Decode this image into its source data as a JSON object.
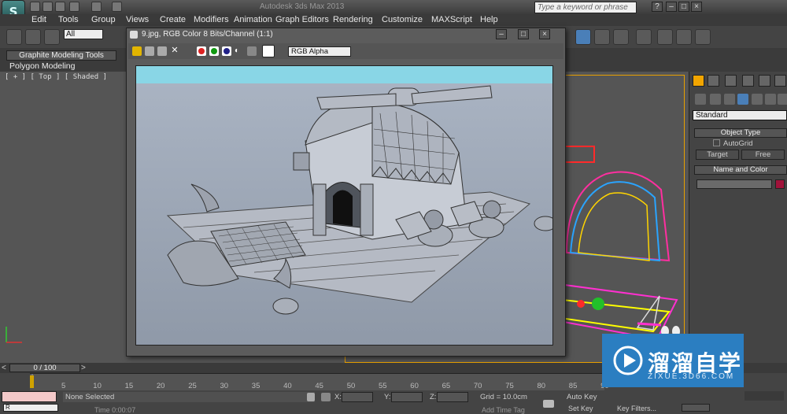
{
  "app": {
    "logo_letter": "S",
    "title_text": "Autodesk 3ds Max 2013",
    "search_placeholder": "Type a keyword or phrase",
    "window_buttons": [
      "–",
      "□",
      "×"
    ]
  },
  "menu": [
    "Edit",
    "Tools",
    "Group",
    "Views",
    "Create",
    "Modifiers",
    "Animation",
    "Graph Editors",
    "Rendering",
    "Customize",
    "MAXScript",
    "Help"
  ],
  "toolbar": {
    "selection_filter": "All"
  },
  "ribbon": {
    "tab_label": "Graphite Modeling Tools",
    "panel_label": "Polygon Modeling"
  },
  "viewport": {
    "label": "[ + ] [ Top ] [ Shaded ]"
  },
  "frame_window": {
    "title": "9.jpg, RGB Color 8 Bits/Channel (1:1)",
    "channel_dropdown": "RGB Alpha",
    "controls": [
      "–",
      "□",
      "×"
    ]
  },
  "command_panel": {
    "dropdown": "Standard",
    "object_type_header": "Object Type",
    "autogrid_label": "AutoGrid",
    "target_button": "Target",
    "free_button": "Free",
    "name_color_header": "Name and Color"
  },
  "timeline": {
    "frame_counter": "0 / 100",
    "ticks": [
      "5",
      "10",
      "15",
      "20",
      "25",
      "30",
      "35",
      "40",
      "45",
      "50",
      "55",
      "60",
      "65",
      "70",
      "75",
      "80",
      "85",
      "90"
    ]
  },
  "status": {
    "selection": "None Selected",
    "x_label": "X:",
    "y_label": "Y:",
    "z_label": "Z:",
    "grid": "Grid = 10.0cm",
    "auto_key": "Auto Key",
    "set_key": "Set Key",
    "key_filters": "Key Filters...",
    "add_time_tag": "Add Time Tag",
    "time_hint": "Time 0:00:07"
  },
  "watermark": {
    "title": "溜溜自学",
    "subtitle": "ZIXUE.3D66.COM"
  },
  "colors": {
    "accent_blue": "#4a7fb8",
    "viewport_border": "#e8a000",
    "sky": "#89d6e6",
    "watermark_blue": "#2b7ec1"
  }
}
